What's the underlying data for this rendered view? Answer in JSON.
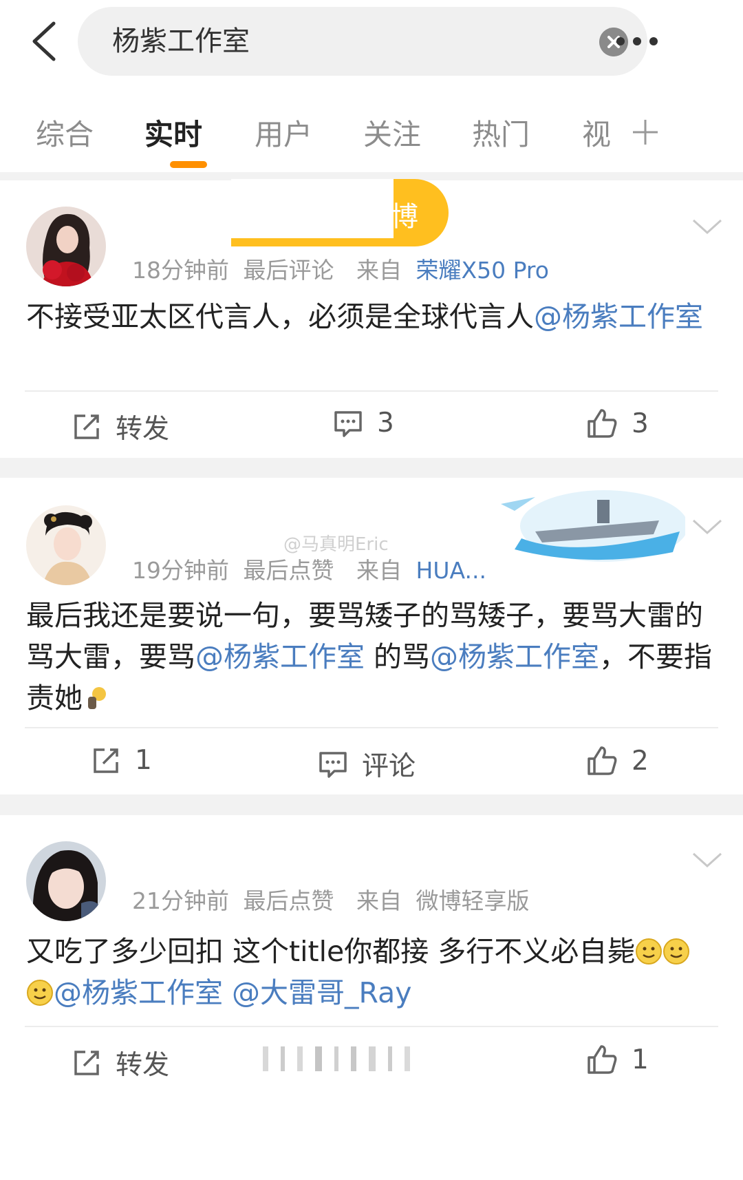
{
  "search": {
    "query": "杨紫工作室"
  },
  "tabs": [
    {
      "label": "综合"
    },
    {
      "label": "实时"
    },
    {
      "label": "用户"
    },
    {
      "label": "关注"
    },
    {
      "label": "热门"
    },
    {
      "label": "视"
    }
  ],
  "colors": {
    "accent": "#ff9000",
    "link": "#4a7dbf"
  },
  "watermark": "@马真明Eric",
  "posts": [
    {
      "time": "18分钟前",
      "activity": "最后评论",
      "from_prefix": "来自",
      "source": "荣耀X50 Pro",
      "text_plain": "不接受亚太区代言人，必须是全球代言人",
      "mention1": "@杨紫工作室",
      "badge_partial": "博",
      "actions": {
        "repost": "转发",
        "comments": "3",
        "likes": "3"
      }
    },
    {
      "time": "19分钟前",
      "activity": "最后点赞",
      "from_prefix": "来自",
      "source": "HUA...",
      "text_a": "最后我还是要说一句，要骂矮子的骂矮子，要骂大雷的骂大雷，要骂",
      "mention1": "@杨紫工作室",
      "text_b": " 的骂",
      "mention2": "@杨紫工作室",
      "text_c": "，不要指责她",
      "actions": {
        "repost": "1",
        "comments": "评论",
        "likes": "2"
      }
    },
    {
      "time": "21分钟前",
      "activity": "最后点赞",
      "from_prefix": "来自",
      "source": "微博轻享版",
      "text_a": "又吃了多少回扣 这个title你都接 多行不义必自毙",
      "mention1": "@杨紫工作室",
      "text_b": " ",
      "mention2": "@大雷哥_Ray",
      "actions": {
        "repost": "转发",
        "likes": "1"
      }
    }
  ]
}
